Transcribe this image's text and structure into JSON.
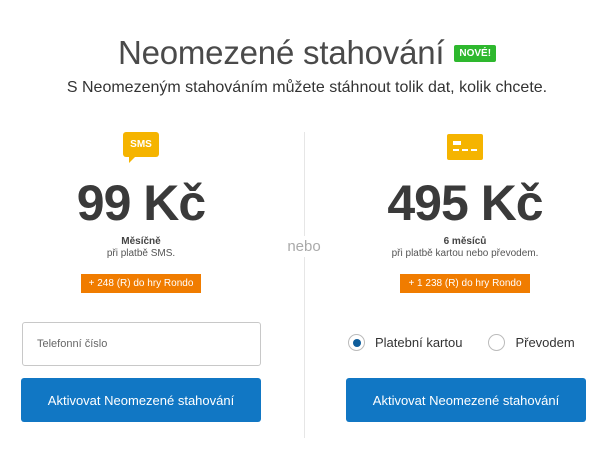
{
  "header": {
    "title": "Neomezené stahování",
    "badge": "NOVÉ!",
    "subtitle": "S Neomezeným stahováním můžete stáhnout tolik dat, kolik chcete."
  },
  "separator": "nebo",
  "sms_plan": {
    "icon": "sms-icon",
    "icon_label": "SMS",
    "price": "99 Kč",
    "period": "Měsíčně",
    "note": "při platbě SMS.",
    "bonus": "+ 248 (R) do hry Rondo",
    "phone_placeholder": "Telefonní číslo",
    "button": "Aktivovat Neomezené stahování"
  },
  "card_plan": {
    "icon": "credit-card-icon",
    "price": "495 Kč",
    "period": "6 měsíců",
    "note": "při platbě kartou nebo převodem.",
    "bonus": "+ 1 238 (R) do hry Rondo",
    "payment_options": [
      {
        "label": "Platební kartou",
        "selected": true
      },
      {
        "label": "Převodem",
        "selected": false
      }
    ],
    "button": "Aktivovat Neomezené stahování"
  },
  "colors": {
    "accent_button": "#1177c4",
    "badge_green": "#2eb82e",
    "bonus_orange": "#f07c00",
    "icon_yellow": "#f5b400"
  }
}
